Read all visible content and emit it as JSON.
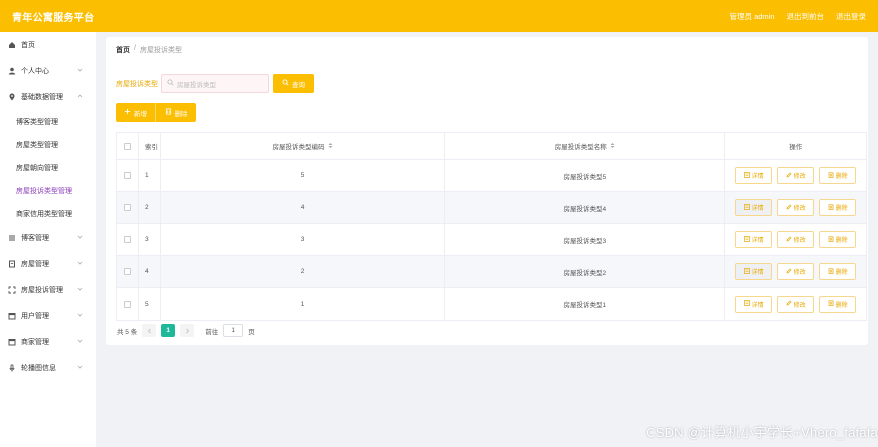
{
  "header": {
    "title": "青年公寓服务平台",
    "user_label": "管理员 admin",
    "nav": [
      "退出到前台",
      "退出登录"
    ]
  },
  "sidebar": {
    "items": [
      {
        "label": "首页",
        "icon": "home-icon",
        "has_arrow": false
      },
      {
        "label": "个人中心",
        "icon": "user-icon",
        "has_arrow": true
      },
      {
        "label": "基础数据管理",
        "icon": "location-icon",
        "has_arrow": true,
        "expanded": true
      },
      {
        "label": "博客管理",
        "icon": "list-icon",
        "has_arrow": true
      },
      {
        "label": "房屋管理",
        "icon": "document-icon",
        "has_arrow": true
      },
      {
        "label": "房屋投诉管理",
        "icon": "expand-icon",
        "has_arrow": true
      },
      {
        "label": "用户管理",
        "icon": "folder-icon",
        "has_arrow": true
      },
      {
        "label": "商家管理",
        "icon": "folder-icon",
        "has_arrow": true
      },
      {
        "label": "轮播图信息",
        "icon": "microphone-icon",
        "has_arrow": true
      }
    ],
    "submenu": [
      {
        "label": "博客类型管理",
        "active": false
      },
      {
        "label": "房屋类型管理",
        "active": false
      },
      {
        "label": "房屋朝向管理",
        "active": false
      },
      {
        "label": "房屋投诉类型管理",
        "active": true
      },
      {
        "label": "商家信用类型管理",
        "active": false
      }
    ]
  },
  "breadcrumb": {
    "home": "首页",
    "separator": "/",
    "current": "房屋投诉类型"
  },
  "search": {
    "label": "房屋投诉类型",
    "placeholder": "房屋投诉类型",
    "button": "查询"
  },
  "actions": {
    "add": "新增",
    "delete": "删除"
  },
  "table": {
    "columns": {
      "index": "索引",
      "code": "房屋投诉类型编码",
      "name": "房屋投诉类型名称",
      "ops": "操作"
    },
    "rows": [
      {
        "index": "1",
        "code": "5",
        "name": "房屋投诉类型5"
      },
      {
        "index": "2",
        "code": "4",
        "name": "房屋投诉类型4"
      },
      {
        "index": "3",
        "code": "3",
        "name": "房屋投诉类型3"
      },
      {
        "index": "4",
        "code": "2",
        "name": "房屋投诉类型2"
      },
      {
        "index": "5",
        "code": "1",
        "name": "房屋投诉类型1"
      }
    ],
    "row_ops": {
      "detail": "详情",
      "edit": "修改",
      "delete": "删除"
    }
  },
  "pagination": {
    "total": "共 5 条",
    "current_page": "1",
    "goto_label": "前往",
    "goto_value": "1",
    "page_suffix": "页"
  },
  "watermark": "CSDN @计算机小宇学长+Vhero_fafafa",
  "colors": {
    "brand": "#fbbe00",
    "active_menu": "#8a3ab9",
    "page_active": "#1fb99a"
  }
}
